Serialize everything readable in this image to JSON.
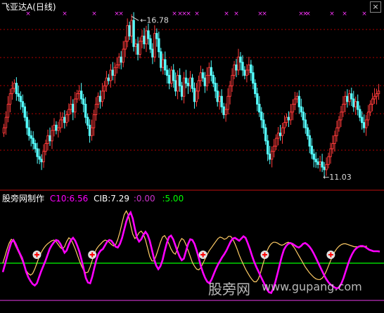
{
  "header": {
    "title": "飞亚达A",
    "period": "(日线)"
  },
  "top_pane": {
    "max_label": "16.78",
    "min_label": "11.03"
  },
  "indicator": {
    "name": "股旁网制作",
    "c10": "C10:6.56",
    "cib": "CIB:7.29",
    "v3": ":0.00",
    "v4": ":5.00"
  },
  "watermark": {
    "cn": "股旁网",
    "url": "www.gupang.com"
  },
  "colors": {
    "up": "#ff3a3a",
    "down": "#54ffff",
    "grid": "#b00000",
    "c10": "#ff00ff",
    "cib": "#ffffff",
    "green": "#00ff00",
    "purple": "#cc33cc",
    "orange": "#ffcc66",
    "marker": "#e0e0e0"
  },
  "chart_data": [
    {
      "type": "candlestick",
      "title": "飞亚达A (日线)",
      "x": [
        1,
        2,
        3,
        4,
        5,
        6,
        7,
        8,
        9,
        10,
        11,
        12,
        13,
        14,
        15,
        16,
        17,
        18,
        19,
        20,
        21,
        22,
        23,
        24,
        25,
        26,
        27,
        28,
        29,
        30,
        31,
        32,
        33,
        34,
        35,
        36,
        37,
        38,
        39,
        40,
        41,
        42,
        43,
        44,
        45,
        46,
        47,
        48,
        49,
        50,
        51,
        52,
        53,
        54,
        55,
        56,
        57,
        58,
        59,
        60,
        61,
        62,
        63,
        64,
        65,
        66,
        67,
        68,
        69,
        70,
        71,
        72,
        73,
        74,
        75,
        76,
        77,
        78,
        79,
        80,
        81,
        82,
        83,
        84,
        85,
        86,
        87,
        88,
        89,
        90,
        91,
        92,
        93,
        94,
        95,
        96,
        97,
        98,
        99,
        100,
        101,
        102,
        103,
        104,
        105,
        106,
        107,
        108,
        109,
        110,
        111,
        112,
        113,
        114,
        115,
        116,
        117,
        118,
        119,
        120,
        121,
        122,
        123,
        124,
        125,
        126,
        127,
        128,
        129,
        130,
        131,
        132,
        133,
        134,
        135,
        136,
        137,
        138,
        139,
        140,
        141,
        142,
        143,
        144,
        145,
        146,
        147,
        148,
        149,
        150,
        151,
        152,
        153,
        154,
        155,
        156,
        157,
        158,
        159,
        160,
        161,
        162,
        163,
        164,
        165,
        166,
        167,
        168,
        169,
        170,
        171,
        172,
        173,
        174,
        175,
        176,
        177,
        178,
        179,
        180
      ],
      "close": [
        12.6,
        13.0,
        13.5,
        13.9,
        14.1,
        14.3,
        13.9,
        13.8,
        13.6,
        13.4,
        13.0,
        12.6,
        12.3,
        12.2,
        12.0,
        11.8,
        11.5,
        11.4,
        11.3,
        11.7,
        12.0,
        12.3,
        12.1,
        12.5,
        12.7,
        12.5,
        12.6,
        12.9,
        13.0,
        12.8,
        13.1,
        13.3,
        13.5,
        13.2,
        13.7,
        13.9,
        14.0,
        13.7,
        13.5,
        13.0,
        12.7,
        12.3,
        12.6,
        13.1,
        13.5,
        13.8,
        13.6,
        14.0,
        14.2,
        14.5,
        14.4,
        14.8,
        14.6,
        14.9,
        15.0,
        15.3,
        15.1,
        15.6,
        15.9,
        16.5,
        16.1,
        16.7,
        15.7,
        15.8,
        15.4,
        15.9,
        16.1,
        15.8,
        16.3,
        16.0,
        15.6,
        15.3,
        16.2,
        16.0,
        15.5,
        14.9,
        15.2,
        14.8,
        14.6,
        14.3,
        14.8,
        14.4,
        14.0,
        14.6,
        14.2,
        13.8,
        14.5,
        14.3,
        14.2,
        14.5,
        14.1,
        13.6,
        14.0,
        14.4,
        14.7,
        14.5,
        14.2,
        14.6,
        14.9,
        14.6,
        14.3,
        14.0,
        13.6,
        13.8,
        13.4,
        13.1,
        13.3,
        13.8,
        14.2,
        14.6,
        15.0,
        14.8,
        15.3,
        15.1,
        14.8,
        14.6,
        14.8,
        15.0,
        14.7,
        14.3,
        13.9,
        13.5,
        13.2,
        12.9,
        12.6,
        12.1,
        11.6,
        11.4,
        11.7,
        11.9,
        12.2,
        12.4,
        12.3,
        12.6,
        12.8,
        13.0,
        12.9,
        13.2,
        13.5,
        13.7,
        13.8,
        13.4,
        13.2,
        12.9,
        12.6,
        12.3,
        11.9,
        11.6,
        11.4,
        11.3,
        11.2,
        11.3,
        11.1,
        11.0,
        11.2,
        11.5,
        11.8,
        12.0,
        12.3,
        12.6,
        12.9,
        13.2,
        13.5,
        13.8,
        13.6,
        13.9,
        13.7,
        13.4,
        13.6,
        13.3,
        13.0,
        12.8,
        12.6,
        12.9,
        13.2,
        13.5,
        13.7,
        13.8,
        13.9,
        14.0
      ],
      "price_range": [
        10.3,
        17.1
      ],
      "annotations": [
        "16.78",
        "11.03"
      ]
    },
    {
      "type": "line",
      "title": "股旁网制作",
      "series": [
        {
          "name": "C10",
          "values": [
            3.8,
            4.8,
            5.9,
            6.9,
            7.8,
            8.1,
            7.6,
            6.9,
            6.3,
            5.7,
            4.8,
            3.8,
            3.1,
            2.6,
            2.2,
            2.0,
            2.3,
            3.1,
            3.9,
            4.6,
            5.3,
            6.1,
            6.9,
            7.4,
            7.8,
            8.1,
            8.0,
            7.6,
            7.0,
            6.4,
            6.7,
            7.5,
            8.1,
            8.4,
            8.0,
            7.3,
            6.5,
            5.4,
            4.2,
            3.0,
            2.4,
            2.3,
            3.2,
            4.4,
            5.5,
            6.3,
            6.7,
            6.9,
            7.4,
            7.9,
            8.1,
            8.0,
            7.6,
            7.2,
            7.1,
            7.6,
            8.4,
            9.5,
            10.6,
            11.4,
            11.8,
            11.0,
            9.6,
            8.4,
            7.9,
            8.2,
            8.8,
            9.2,
            8.8,
            8.0,
            6.8,
            5.6,
            4.7,
            4.2,
            4.6,
            5.4,
            6.6,
            7.7,
            8.5,
            8.7,
            8.2,
            7.4,
            6.6,
            5.9,
            5.4,
            5.6,
            6.6,
            7.6,
            8.2,
            8.1,
            7.6,
            6.7,
            5.7,
            4.6,
            3.7,
            3.0,
            2.5,
            2.3,
            2.8,
            3.5,
            4.2,
            4.8,
            5.3,
            5.8,
            6.2,
            6.7,
            7.3,
            7.9,
            8.3,
            8.4,
            8.2,
            8.0,
            8.3,
            8.6,
            8.4,
            7.7,
            6.9,
            6.0,
            5.2,
            4.5,
            3.9,
            3.3,
            2.7,
            2.1,
            1.5,
            1.1,
            1.0,
            1.6,
            2.5,
            3.6,
            4.8,
            5.9,
            6.8,
            7.3,
            7.6,
            7.7,
            7.6,
            7.4,
            7.2,
            7.1,
            7.3,
            7.6,
            7.7,
            7.5,
            7.2,
            6.8,
            6.3,
            5.7,
            5.1,
            4.5,
            3.9,
            3.3,
            2.8,
            2.4,
            2.1,
            1.9,
            1.7,
            1.6,
            1.8,
            2.3,
            3.0,
            3.9,
            4.8,
            5.6,
            6.2,
            6.7,
            7.0,
            7.2,
            7.3,
            7.3,
            7.2,
            7.0,
            6.8,
            6.7,
            6.6,
            6.6,
            6.6,
            6.56
          ]
        },
        {
          "name": "CIB",
          "values": [
            5.0,
            5.9,
            6.9,
            7.7,
            8.2,
            8.0,
            7.3,
            6.7,
            6.1,
            5.4,
            4.6,
            4.0,
            3.6,
            3.4,
            3.6,
            4.2,
            5.0,
            5.8,
            6.4,
            6.9,
            7.3,
            7.6,
            7.8,
            8.0,
            8.1,
            7.9,
            7.5,
            7.1,
            6.9,
            7.2,
            7.9,
            8.4,
            8.2,
            7.6,
            6.9,
            6.1,
            5.3,
            4.6,
            4.0,
            3.7,
            3.8,
            4.5,
            5.4,
            6.3,
            6.9,
            7.3,
            7.6,
            7.9,
            8.1,
            8.0,
            7.8,
            7.5,
            7.3,
            7.5,
            8.2,
            9.2,
            10.4,
            11.5,
            12.0,
            11.4,
            10.1,
            8.9,
            8.3,
            8.6,
            9.1,
            9.3,
            8.9,
            8.1,
            7.0,
            5.9,
            5.3,
            5.3,
            6.0,
            6.9,
            7.8,
            8.5,
            8.7,
            8.2,
            7.6,
            6.9,
            6.4,
            6.2,
            6.9,
            7.8,
            8.3,
            8.1,
            7.5,
            6.7,
            5.9,
            5.1,
            4.6,
            4.2,
            4.1,
            4.4,
            5.0,
            5.6,
            6.2,
            6.7,
            7.1,
            7.5,
            7.9,
            8.3,
            8.5,
            8.4,
            8.2,
            8.3,
            8.6,
            8.6,
            8.2,
            7.6,
            6.9,
            6.1,
            5.4,
            4.8,
            4.2,
            3.7,
            3.2,
            2.8,
            2.5,
            2.5,
            2.9,
            3.7,
            4.7,
            5.7,
            6.6,
            7.2,
            7.6,
            7.8,
            7.8,
            7.7,
            7.5,
            7.4,
            7.5,
            7.7,
            7.8,
            7.7,
            7.4,
            7.0,
            6.5,
            6.0,
            5.5,
            5.0,
            4.5,
            4.1,
            3.7,
            3.4,
            3.1,
            2.9,
            2.8,
            2.8,
            3.0,
            3.4,
            4.0,
            4.7,
            5.4,
            6.1,
            6.6,
            7.0,
            7.3,
            7.5,
            7.6,
            7.6,
            7.5,
            7.4,
            7.3,
            7.2,
            7.2,
            7.2,
            7.2,
            7.2,
            7.25,
            7.29
          ]
        }
      ],
      "hlines": [
        0,
        5
      ],
      "y_range": [
        -1.5,
        13
      ]
    }
  ]
}
